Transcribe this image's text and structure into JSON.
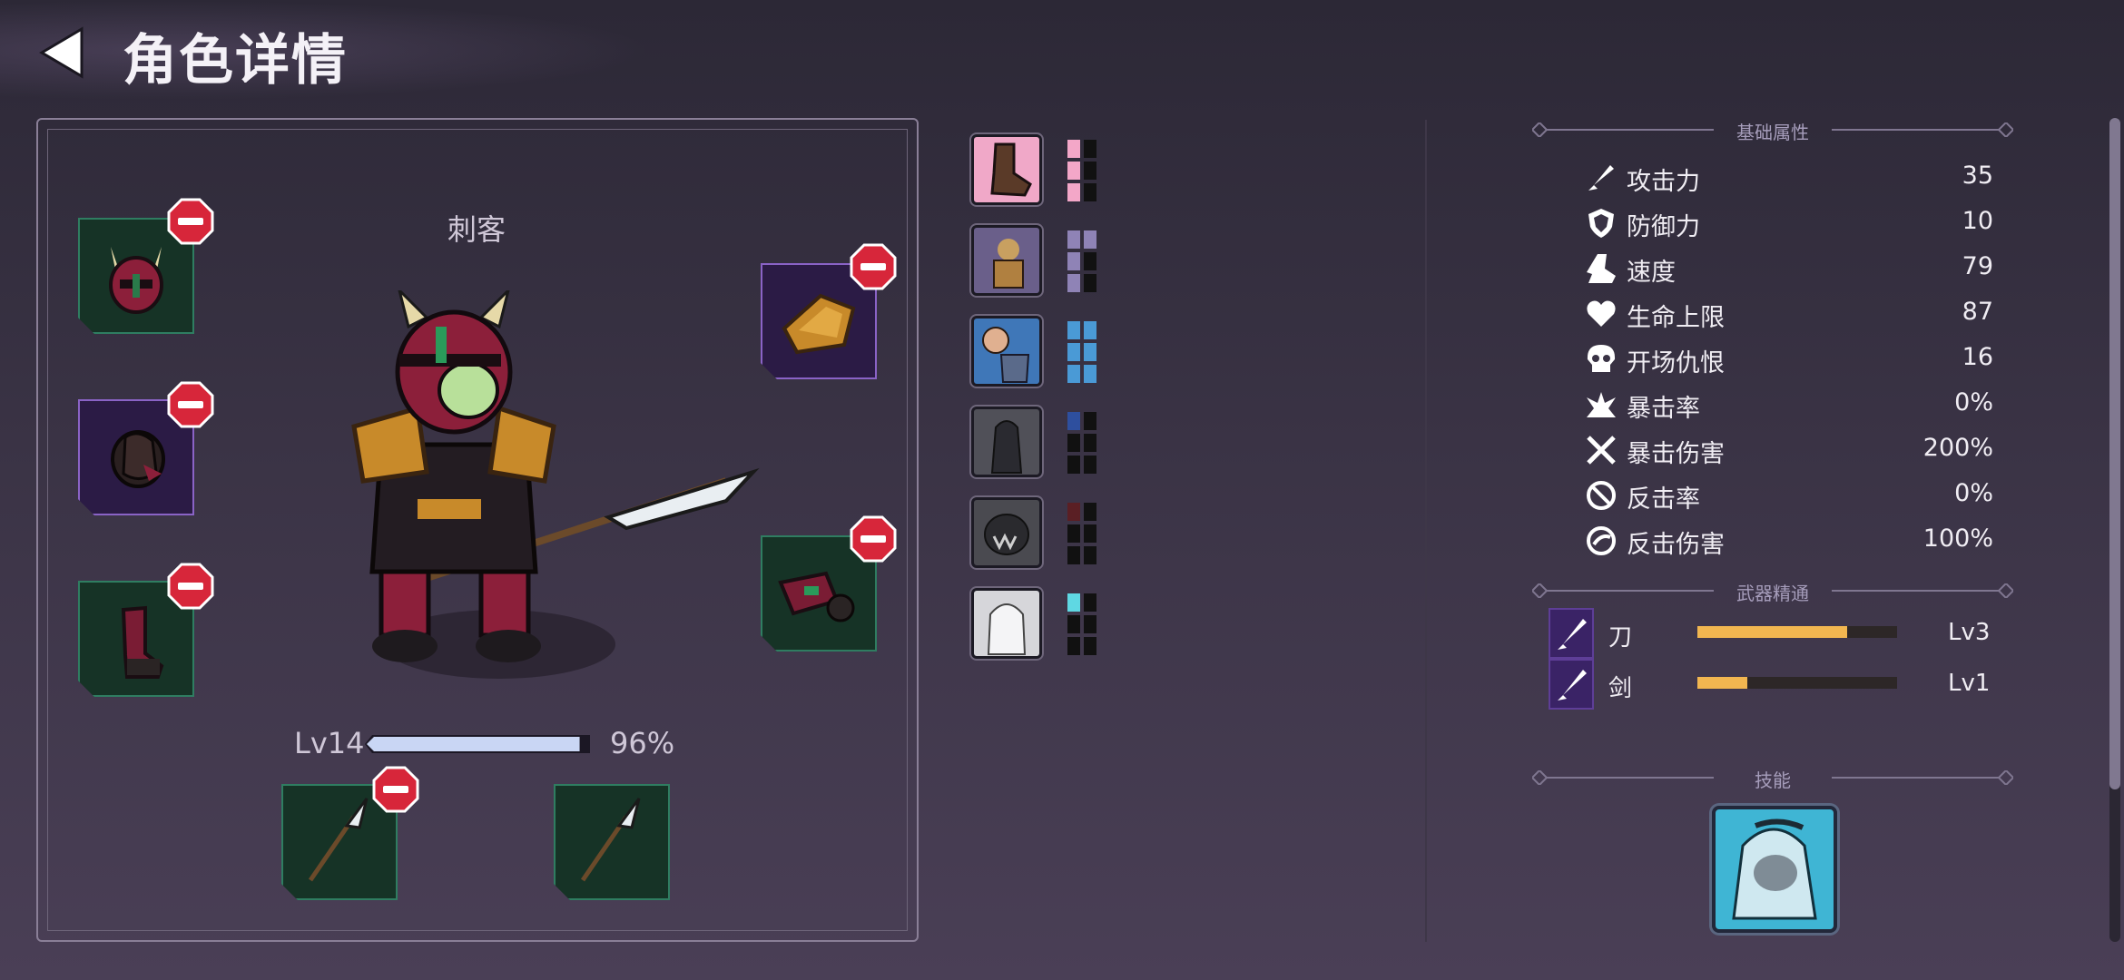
{
  "header": {
    "title": "角色详情",
    "back_icon": "back-arrow-icon"
  },
  "character": {
    "class_name": "刺客",
    "level_label": "Lv14",
    "xp_percent_label": "96%",
    "xp_fraction": 0.96
  },
  "equipment": [
    {
      "slot": "helmet",
      "icon": "horned-helmet-icon",
      "rarity": "green",
      "removable": true
    },
    {
      "slot": "armor",
      "icon": "dark-armor-icon",
      "rarity": "purple",
      "removable": true
    },
    {
      "slot": "boots",
      "icon": "boot-icon",
      "rarity": "green",
      "removable": true
    },
    {
      "slot": "shoulder",
      "icon": "gold-shoulder-icon",
      "rarity": "purple",
      "removable": true
    },
    {
      "slot": "gloves",
      "icon": "gauntlet-icon",
      "rarity": "green",
      "removable": true
    },
    {
      "slot": "weapon-main",
      "icon": "glaive-icon",
      "rarity": "green",
      "removable": true
    },
    {
      "slot": "weapon-off",
      "icon": "glaive-icon",
      "rarity": "green",
      "removable": false
    }
  ],
  "buffs": [
    {
      "icon": "kick-icon",
      "color": "#f3a7c8",
      "filled": 3,
      "total": 6
    },
    {
      "icon": "brute-icon",
      "color": "#8f83b6",
      "filled": 3,
      "total": 6
    },
    {
      "icon": "punch-icon",
      "color": "#4a9ad6",
      "filled": 6,
      "total": 6
    },
    {
      "icon": "shadow-figure-icon",
      "color": "#2e4f9e",
      "filled": 1,
      "total": 6
    },
    {
      "icon": "fanged-beast-icon",
      "color": "#5a1f24",
      "filled": 1,
      "total": 6
    },
    {
      "icon": "ghost-icon",
      "color": "#5fd8e3",
      "filled": 1,
      "total": 6
    }
  ],
  "attributes": {
    "section_title": "基础属性",
    "stats": [
      {
        "icon": "sword-icon",
        "label": "攻击力",
        "value": "35"
      },
      {
        "icon": "shield-icon",
        "label": "防御力",
        "value": "10"
      },
      {
        "icon": "boot-speed-icon",
        "label": "速度",
        "value": "79"
      },
      {
        "icon": "heart-icon",
        "label": "生命上限",
        "value": "87"
      },
      {
        "icon": "skull-icon",
        "label": "开场仇恨",
        "value": "16"
      },
      {
        "icon": "crit-burst-icon",
        "label": "暴击率",
        "value": "0%"
      },
      {
        "icon": "crossed-swords-icon",
        "label": "暴击伤害",
        "value": "200%"
      },
      {
        "icon": "counter-icon",
        "label": "反击率",
        "value": "0%"
      },
      {
        "icon": "counter-damage-icon",
        "label": "反击伤害",
        "value": "100%"
      }
    ]
  },
  "weapon_mastery": {
    "section_title": "武器精通",
    "items": [
      {
        "icon": "blade-icon",
        "name": "刀",
        "level": "Lv3",
        "progress": 0.75
      },
      {
        "icon": "sword-icon",
        "name": "剑",
        "level": "Lv1",
        "progress": 0.25
      }
    ]
  },
  "skills": {
    "section_title": "技能",
    "icon": "hooded-rogue-skill-icon"
  }
}
